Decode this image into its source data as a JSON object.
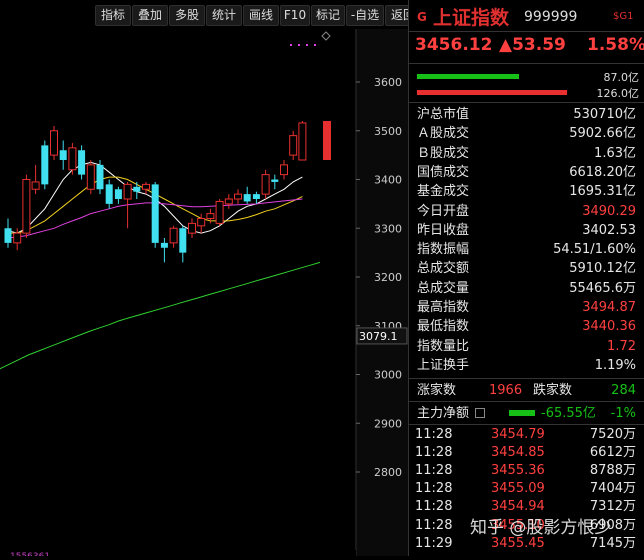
{
  "toolbar": [
    "指标",
    "叠加",
    "多股",
    "统计",
    "画线",
    "F10",
    "标记",
    "-自选",
    "返回"
  ],
  "chart": {
    "y_ticks": [
      "3600",
      "3500",
      "3400",
      "3300",
      "3200",
      "3100",
      "3000",
      "2900",
      "2800"
    ],
    "last_price_label": "3079.1",
    "bottom_label": "1556361"
  },
  "chart_data": {
    "type": "candlestick",
    "y_axis_ticks": [
      3600,
      3500,
      3400,
      3300,
      3200,
      3100,
      3000,
      2900,
      2800
    ],
    "candles": [
      {
        "o": 3300,
        "c": 3270,
        "h": 3320,
        "l": 3260
      },
      {
        "o": 3270,
        "c": 3290,
        "h": 3300,
        "l": 3255
      },
      {
        "o": 3290,
        "c": 3400,
        "h": 3410,
        "l": 3280
      },
      {
        "o": 3380,
        "c": 3395,
        "h": 3430,
        "l": 3370
      },
      {
        "o": 3470,
        "c": 3390,
        "h": 3480,
        "l": 3380
      },
      {
        "o": 3450,
        "c": 3500,
        "h": 3510,
        "l": 3440
      },
      {
        "o": 3460,
        "c": 3440,
        "h": 3480,
        "l": 3420
      },
      {
        "o": 3420,
        "c": 3465,
        "h": 3475,
        "l": 3410
      },
      {
        "o": 3460,
        "c": 3410,
        "h": 3470,
        "l": 3400
      },
      {
        "o": 3380,
        "c": 3430,
        "h": 3440,
        "l": 3370
      },
      {
        "o": 3430,
        "c": 3380,
        "h": 3440,
        "l": 3370
      },
      {
        "o": 3390,
        "c": 3350,
        "h": 3400,
        "l": 3340
      },
      {
        "o": 3380,
        "c": 3360,
        "h": 3385,
        "l": 3350
      },
      {
        "o": 3360,
        "c": 3390,
        "h": 3395,
        "l": 3300
      },
      {
        "o": 3385,
        "c": 3375,
        "h": 3395,
        "l": 3360
      },
      {
        "o": 3380,
        "c": 3390,
        "h": 3395,
        "l": 3370
      },
      {
        "o": 3390,
        "c": 3270,
        "h": 3395,
        "l": 3260
      },
      {
        "o": 3270,
        "c": 3260,
        "h": 3280,
        "l": 3230
      },
      {
        "o": 3270,
        "c": 3300,
        "h": 3305,
        "l": 3260
      },
      {
        "o": 3300,
        "c": 3250,
        "h": 3305,
        "l": 3230
      },
      {
        "o": 3290,
        "c": 3310,
        "h": 3320,
        "l": 3280
      },
      {
        "o": 3305,
        "c": 3320,
        "h": 3330,
        "l": 3290
      },
      {
        "o": 3320,
        "c": 3330,
        "h": 3340,
        "l": 3310
      },
      {
        "o": 3310,
        "c": 3355,
        "h": 3360,
        "l": 3305
      },
      {
        "o": 3350,
        "c": 3360,
        "h": 3370,
        "l": 3340
      },
      {
        "o": 3360,
        "c": 3370,
        "h": 3380,
        "l": 3350
      },
      {
        "o": 3370,
        "c": 3355,
        "h": 3385,
        "l": 3350
      },
      {
        "o": 3370,
        "c": 3360,
        "h": 3375,
        "l": 3350
      },
      {
        "o": 3370,
        "c": 3410,
        "h": 3420,
        "l": 3360
      },
      {
        "o": 3400,
        "c": 3395,
        "h": 3410,
        "l": 3380
      },
      {
        "o": 3410,
        "c": 3430,
        "h": 3440,
        "l": 3400
      },
      {
        "o": 3450,
        "c": 3490,
        "h": 3500,
        "l": 3440
      },
      {
        "o": 3440,
        "c": 3516,
        "h": 3520,
        "l": 3440
      }
    ],
    "ma_lines": [
      {
        "color": "#ffffff",
        "values": [
          3295,
          3290,
          3300,
          3320,
          3340,
          3370,
          3400,
          3420,
          3430,
          3435,
          3430,
          3415,
          3400,
          3385,
          3375,
          3370,
          3360,
          3345,
          3325,
          3305,
          3295,
          3290,
          3295,
          3305,
          3320,
          3335,
          3345,
          3350,
          3360,
          3370,
          3380,
          3395,
          3405
        ]
      },
      {
        "color": "#f0d020",
        "values": [
          3290,
          3290,
          3295,
          3305,
          3315,
          3330,
          3345,
          3360,
          3375,
          3390,
          3400,
          3405,
          3405,
          3400,
          3390,
          3380,
          3370,
          3360,
          3350,
          3340,
          3330,
          3320,
          3315,
          3315,
          3315,
          3318,
          3322,
          3328,
          3335,
          3340,
          3348,
          3356,
          3365
        ]
      },
      {
        "color": "#e040e0",
        "values": [
          3280,
          3282,
          3285,
          3290,
          3295,
          3300,
          3308,
          3315,
          3322,
          3330,
          3335,
          3340,
          3345,
          3348,
          3350,
          3352,
          3352,
          3350,
          3348,
          3346,
          3344,
          3344,
          3345,
          3346,
          3347,
          3348,
          3349,
          3350,
          3352,
          3354,
          3356,
          3358,
          3360
        ]
      },
      {
        "color": "#30d030",
        "values": [
          3010,
          3020,
          3030,
          3040,
          3048,
          3056,
          3064,
          3072,
          3080,
          3088,
          3095,
          3102,
          3110,
          3116,
          3122,
          3128,
          3134,
          3140,
          3146,
          3152,
          3158,
          3164,
          3170,
          3176,
          3182,
          3188,
          3194,
          3200,
          3206,
          3212,
          3218,
          3224,
          3230
        ]
      }
    ]
  },
  "header": {
    "g": "G",
    "name": "上证指数",
    "code": "999999",
    "tag": "$G1",
    "price": "3456.12",
    "change": "▲53.59",
    "pct": "1.58%"
  },
  "volume_bars": {
    "buy_label": "87.0亿",
    "sell_label": "126.0亿",
    "buy_fraction": 0.41,
    "sell_fraction": 0.6
  },
  "stats": [
    {
      "k": "沪总市值",
      "v": "530710亿",
      "c": "white"
    },
    {
      "k": "Ａ股成交",
      "v": "5902.66亿",
      "c": "white"
    },
    {
      "k": "Ｂ股成交",
      "v": "1.63亿",
      "c": "white"
    },
    {
      "k": "国债成交",
      "v": "6618.20亿",
      "c": "white"
    },
    {
      "k": "基金成交",
      "v": "1695.31亿",
      "c": "white"
    },
    {
      "k": "今日开盘",
      "v": "3490.29",
      "c": "red"
    },
    {
      "k": "昨日收盘",
      "v": "3402.53",
      "c": "white"
    },
    {
      "k": "指数振幅",
      "v": "54.51/1.60%",
      "c": "white"
    },
    {
      "k": "总成交额",
      "v": "5910.12亿",
      "c": "white"
    },
    {
      "k": "总成交量",
      "v": "55465.6万",
      "c": "white"
    },
    {
      "k": "最高指数",
      "v": "3494.87",
      "c": "red"
    },
    {
      "k": "最低指数",
      "v": "3440.36",
      "c": "red"
    },
    {
      "k": "指数量比",
      "v": "1.72",
      "c": "red"
    },
    {
      "k": "上证换手",
      "v": "1.19%",
      "c": "white"
    }
  ],
  "breadth": {
    "up_label": "涨家数",
    "up": "1966",
    "down_label": "跌家数",
    "down": "284"
  },
  "capital": {
    "label": "主力净额",
    "value": "-65.55亿",
    "pct": "-1%"
  },
  "ticks": [
    {
      "t": "11:28",
      "p": "3454.79",
      "q": "7520万"
    },
    {
      "t": "11:28",
      "p": "3454.85",
      "q": "6612万"
    },
    {
      "t": "11:28",
      "p": "3455.36",
      "q": "8788万"
    },
    {
      "t": "11:28",
      "p": "3455.09",
      "q": "7404万"
    },
    {
      "t": "11:28",
      "p": "3454.94",
      "q": "7312万"
    },
    {
      "t": "11:28",
      "p": "3455.10",
      "q": "6908万"
    },
    {
      "t": "11:29",
      "p": "3455.45",
      "q": "7145万"
    }
  ],
  "watermark": "知乎 @股影方恨少"
}
